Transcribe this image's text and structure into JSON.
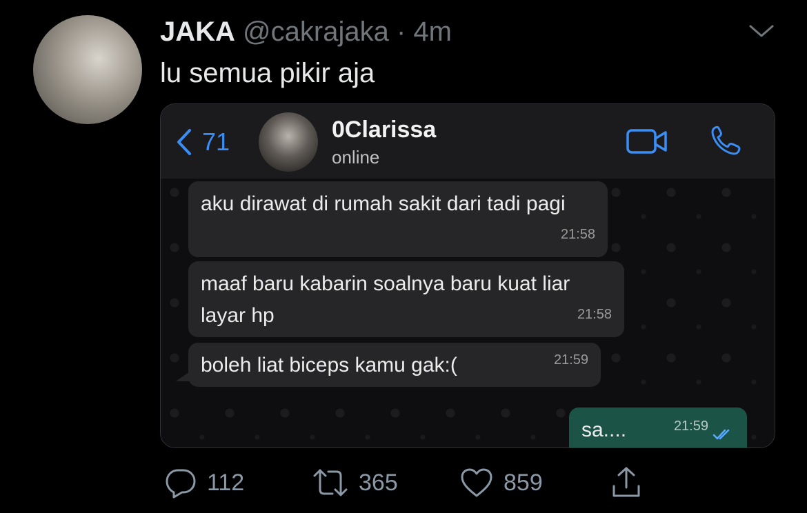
{
  "tweet": {
    "author_name": "JAKA",
    "handle": "@cakrajaka",
    "separator": "·",
    "time": "4m",
    "text": "lu semua pikir aja",
    "menu_icon": "chevron-down-icon"
  },
  "embed": {
    "app": "WhatsApp",
    "header": {
      "back_icon": "chevron-left-icon",
      "back_count": "71",
      "contact_name": "0Clarissa",
      "status": "online",
      "video_icon": "video-call-icon",
      "call_icon": "phone-icon",
      "accent_color": "#3a8ef6"
    },
    "messages": [
      {
        "direction": "incoming",
        "text": "aku dirawat di rumah sakit dari tadi pagi",
        "time": "21:58"
      },
      {
        "direction": "incoming",
        "text": "maaf baru kabarin soalnya baru kuat liar layar hp",
        "time": "21:58"
      },
      {
        "direction": "incoming",
        "text": "boleh liat biceps kamu gak:(",
        "time": "21:59"
      },
      {
        "direction": "outgoing",
        "text": "sa....",
        "time": "21:59",
        "status_icon": "double-check-icon"
      }
    ]
  },
  "actions": {
    "replies": "112",
    "retweets": "365",
    "likes": "859",
    "reply_icon": "reply-icon",
    "retweet_icon": "retweet-icon",
    "like_icon": "heart-icon",
    "share_icon": "share-icon"
  }
}
